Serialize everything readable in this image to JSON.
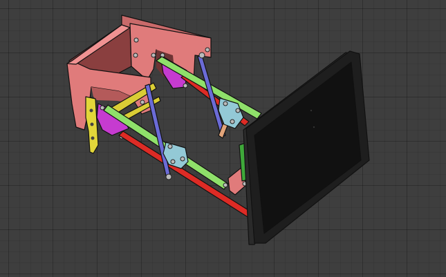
{
  "viewport": {
    "background_color": "#3e3e3e",
    "grid_color": "#2e2e2e",
    "show_grid": true
  },
  "model": {
    "parts": [
      {
        "name": "base-frame",
        "color": "#e07b7b"
      },
      {
        "name": "mounting-bracket",
        "color": "#e2d63a"
      },
      {
        "name": "gusset-plate",
        "color": "#c63bd0"
      },
      {
        "name": "lower-arm",
        "color": "#dd2b25"
      },
      {
        "name": "upper-arm",
        "color": "#8fe06a"
      },
      {
        "name": "support-strut",
        "color": "#6b6bd6"
      },
      {
        "name": "gas-spring",
        "color": "#e3a57a"
      },
      {
        "name": "connector-plate",
        "color": "#93c9d6"
      },
      {
        "name": "monitor-bezel",
        "color": "#1e1e1e"
      },
      {
        "name": "monitor-screen",
        "color": "#111111"
      },
      {
        "name": "monitor-mount",
        "color": "#3fa83a"
      }
    ]
  }
}
